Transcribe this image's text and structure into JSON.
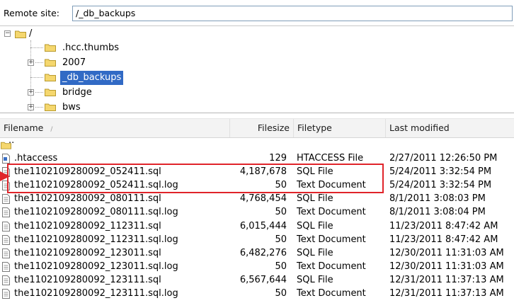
{
  "remote_site": {
    "label": "Remote site:",
    "path": "/_db_backups"
  },
  "tree": {
    "root": "/",
    "items": [
      {
        "label": ".hcc.thumbs",
        "expandable": false,
        "selected": false
      },
      {
        "label": "2007",
        "expandable": true,
        "selected": false
      },
      {
        "label": "_db_backups",
        "expandable": false,
        "selected": true
      },
      {
        "label": "bridge",
        "expandable": true,
        "selected": false
      },
      {
        "label": "bws",
        "expandable": true,
        "selected": false
      }
    ]
  },
  "file_list": {
    "columns": {
      "name": "Filename",
      "size": "Filesize",
      "type": "Filetype",
      "modified": "Last modified"
    },
    "parent": "..",
    "rows": [
      {
        "name": ".htaccess",
        "size": "129",
        "type": "HTACCESS File",
        "modified": "2/27/2011 12:26:50 PM"
      },
      {
        "name": "the1102109280092_052411.sql",
        "size": "4,187,678",
        "type": "SQL File",
        "modified": "5/24/2011 3:32:54 PM"
      },
      {
        "name": "the1102109280092_052411.sql.log",
        "size": "50",
        "type": "Text Document",
        "modified": "5/24/2011 3:32:54 PM"
      },
      {
        "name": "the1102109280092_080111.sql",
        "size": "4,768,454",
        "type": "SQL File",
        "modified": "8/1/2011 3:08:03 PM"
      },
      {
        "name": "the1102109280092_080111.sql.log",
        "size": "50",
        "type": "Text Document",
        "modified": "8/1/2011 3:08:04 PM"
      },
      {
        "name": "the1102109280092_112311.sql",
        "size": "6,015,444",
        "type": "SQL File",
        "modified": "11/23/2011 8:47:42 AM"
      },
      {
        "name": "the1102109280092_112311.sql.log",
        "size": "50",
        "type": "Text Document",
        "modified": "11/23/2011 8:47:42 AM"
      },
      {
        "name": "the1102109280092_123011.sql",
        "size": "6,482,276",
        "type": "SQL File",
        "modified": "12/30/2011 11:31:03 AM"
      },
      {
        "name": "the1102109280092_123011.sql.log",
        "size": "50",
        "type": "Text Document",
        "modified": "12/30/2011 11:31:03 AM"
      },
      {
        "name": "the1102109280092_123111.sql",
        "size": "6,567,644",
        "type": "SQL File",
        "modified": "12/31/2011 11:37:13 AM"
      },
      {
        "name": "the1102109280092_123111.sql.log",
        "size": "50",
        "type": "Text Document",
        "modified": "12/31/2011 11:37:13 AM"
      }
    ]
  },
  "colors": {
    "selection": "#316ac5",
    "highlight": "#e0242a",
    "folder": "#f5d76e"
  }
}
